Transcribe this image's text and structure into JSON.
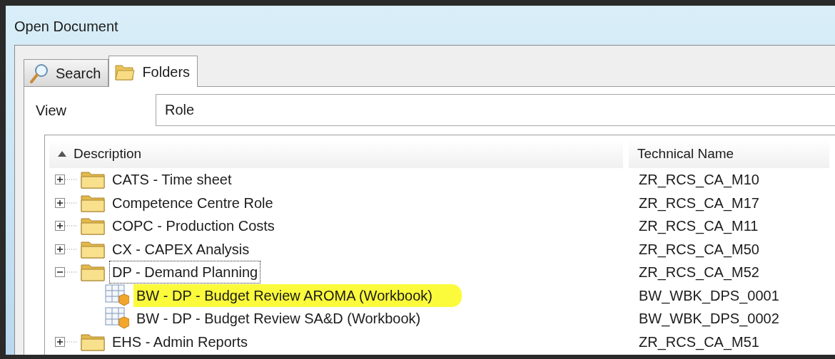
{
  "window": {
    "title": "Open Document"
  },
  "tabs": [
    {
      "label": "Search",
      "kind": "search",
      "selected": false
    },
    {
      "label": "Folders",
      "kind": "folders",
      "selected": true
    }
  ],
  "view": {
    "label": "View",
    "value": "Role"
  },
  "table": {
    "columns": [
      {
        "label": "Description",
        "sorted": true
      },
      {
        "label": "Technical Name"
      }
    ],
    "rows": [
      {
        "kind": "folder",
        "label": "CATS - Time sheet",
        "technical_name": "ZR_RCS_CA_M10",
        "expanded": false,
        "focused": false,
        "highlighted": false
      },
      {
        "kind": "folder",
        "label": "Competence Centre Role",
        "technical_name": "ZR_RCS_CA_M17",
        "expanded": false,
        "focused": false,
        "highlighted": false
      },
      {
        "kind": "folder",
        "label": "COPC - Production Costs",
        "technical_name": "ZR_RCS_CA_M11",
        "expanded": false,
        "focused": false,
        "highlighted": false
      },
      {
        "kind": "folder",
        "label": "CX - CAPEX Analysis",
        "technical_name": "ZR_RCS_CA_M50",
        "expanded": false,
        "focused": false,
        "highlighted": false
      },
      {
        "kind": "folder",
        "label": "DP - Demand Planning",
        "technical_name": "ZR_RCS_CA_M52",
        "expanded": true,
        "focused": true,
        "highlighted": false,
        "children": [
          {
            "kind": "workbook",
            "label": "BW - DP - Budget Review AROMA (Workbook)",
            "technical_name": "BW_WBK_DPS_0001",
            "focused": false,
            "highlighted": true
          },
          {
            "kind": "workbook",
            "label": "BW - DP - Budget Review SA&D (Workbook)",
            "technical_name": "BW_WBK_DPS_0002",
            "focused": false,
            "highlighted": false
          }
        ]
      },
      {
        "kind": "folder",
        "label": "EHS - Admin Reports",
        "technical_name": "ZR_RCS_CA_M51",
        "expanded": false,
        "focused": false,
        "highlighted": false
      }
    ]
  }
}
